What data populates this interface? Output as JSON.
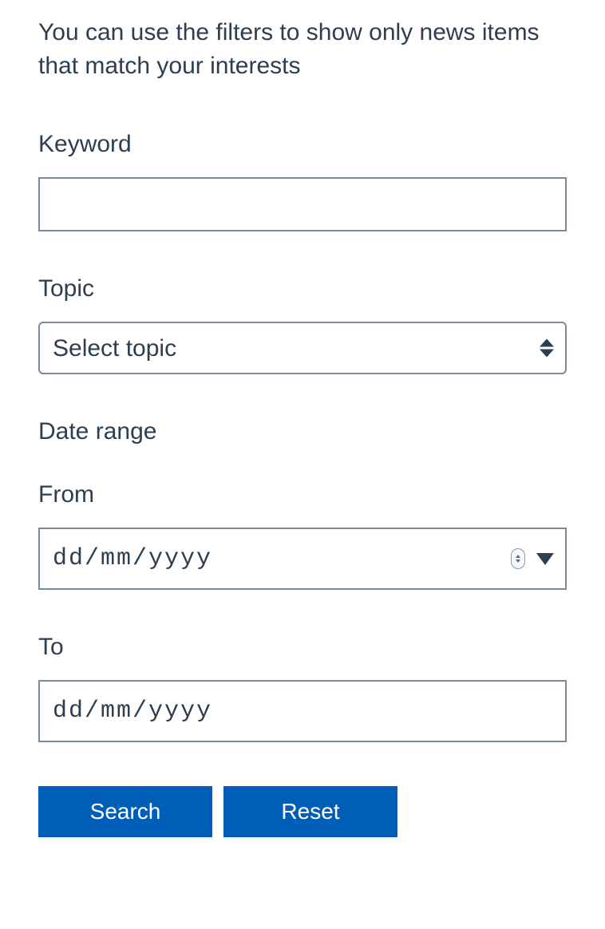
{
  "description": "You can use the filters to show only news items that match your interests",
  "fields": {
    "keyword": {
      "label": "Keyword",
      "value": ""
    },
    "topic": {
      "label": "Topic",
      "selected": "Select topic"
    },
    "date_range": {
      "label": "Date range",
      "from": {
        "label": "From",
        "placeholder": "dd/mm/yyyy",
        "value": ""
      },
      "to": {
        "label": "To",
        "placeholder": "dd/mm/yyyy",
        "value": ""
      }
    }
  },
  "buttons": {
    "search": "Search",
    "reset": "Reset"
  },
  "colors": {
    "primary": "#005eb8",
    "text": "#2c3e50",
    "border": "#7a8a9a"
  }
}
